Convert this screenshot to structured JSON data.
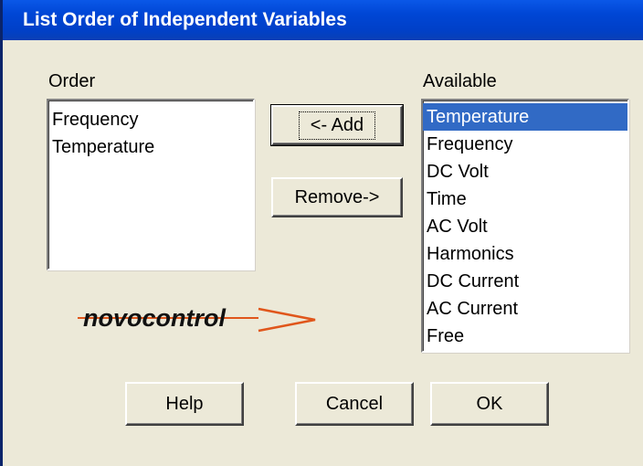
{
  "window": {
    "title": "List Order of Independent Variables"
  },
  "order": {
    "label": "Order",
    "items": [
      "Frequency",
      "Temperature"
    ]
  },
  "available": {
    "label": "Available",
    "items": [
      "Temperature",
      "Frequency",
      "DC Volt",
      "Time",
      "AC Volt",
      "Harmonics",
      "DC Current",
      "AC Current",
      "Free"
    ],
    "selected_index": 0
  },
  "buttons": {
    "add": "<- Add",
    "remove": "Remove->",
    "help": "Help",
    "cancel": "Cancel",
    "ok": "OK"
  },
  "logo": {
    "text": "novocontrol",
    "icon": "arrow-logo-icon"
  },
  "colors": {
    "titlebar": "#0046d5",
    "selection": "#316ac5",
    "dialog_bg": "#ece9d8",
    "logo_accent": "#e0561b"
  }
}
